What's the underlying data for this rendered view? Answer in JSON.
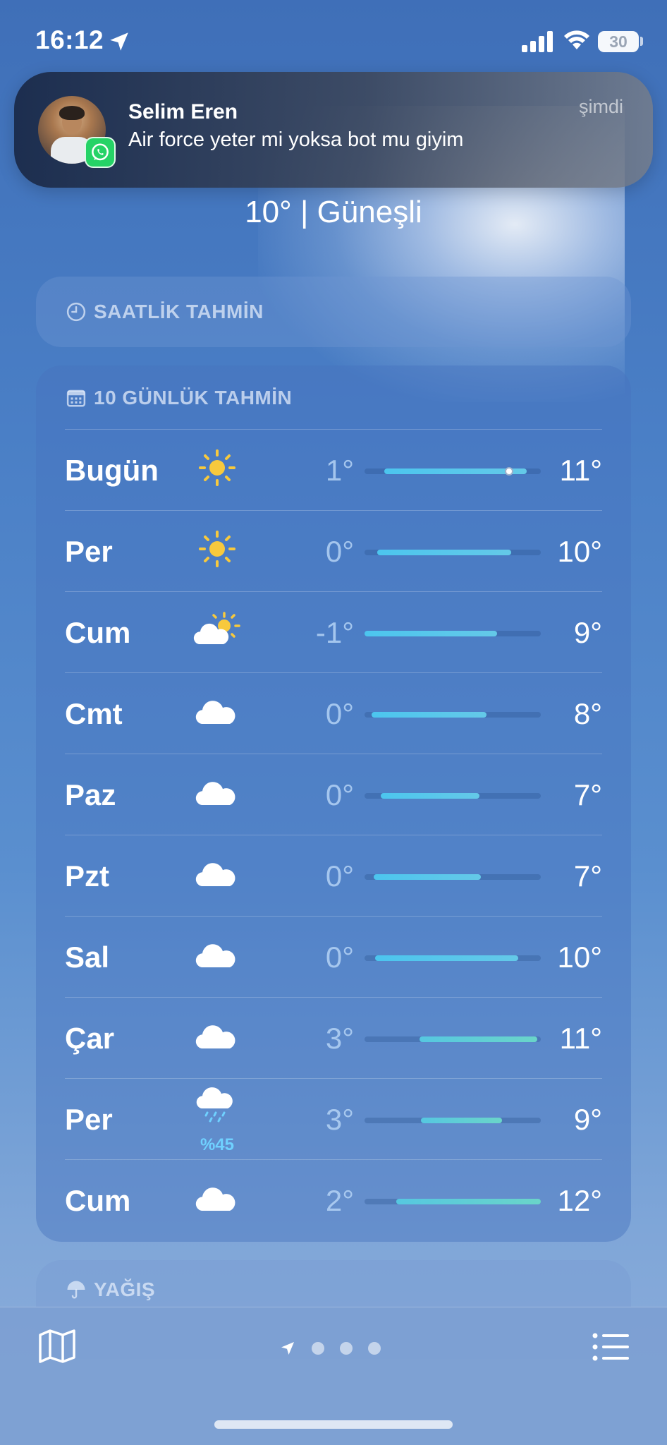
{
  "status_bar": {
    "time": "16:12",
    "battery": "30"
  },
  "notification": {
    "sender": "Selim Eren",
    "message": "Air force yeter mi yoksa bot mu giyim",
    "time": "şimdi",
    "app_icon": "whatsapp-icon"
  },
  "current": {
    "summary": "10°  |  Güneşli"
  },
  "hourly": {
    "title": "SAATLİK TAHMİN",
    "icon": "clock-icon"
  },
  "daily": {
    "title": "10 GÜNLÜK TAHMİN",
    "icon": "calendar-icon",
    "days": [
      {
        "day": "Bugün",
        "icon": "sun",
        "precip": "",
        "low": "1°",
        "high": "11°",
        "bar_start": 0.11,
        "bar_end": 0.92,
        "current": 0.82,
        "color": "blue"
      },
      {
        "day": "Per",
        "icon": "sun",
        "precip": "",
        "low": "0°",
        "high": "10°",
        "bar_start": 0.07,
        "bar_end": 0.83,
        "current": null,
        "color": "blue"
      },
      {
        "day": "Cum",
        "icon": "partly-cloudy",
        "precip": "",
        "low": "-1°",
        "high": "9°",
        "bar_start": 0.0,
        "bar_end": 0.75,
        "current": null,
        "color": "blue"
      },
      {
        "day": "Cmt",
        "icon": "cloud",
        "precip": "",
        "low": "0°",
        "high": "8°",
        "bar_start": 0.04,
        "bar_end": 0.69,
        "current": null,
        "color": "blue"
      },
      {
        "day": "Paz",
        "icon": "cloud",
        "precip": "",
        "low": "0°",
        "high": "7°",
        "bar_start": 0.09,
        "bar_end": 0.65,
        "current": null,
        "color": "blue"
      },
      {
        "day": "Pzt",
        "icon": "cloud",
        "precip": "",
        "low": "0°",
        "high": "7°",
        "bar_start": 0.05,
        "bar_end": 0.66,
        "current": null,
        "color": "blue"
      },
      {
        "day": "Sal",
        "icon": "cloud",
        "precip": "",
        "low": "0°",
        "high": "10°",
        "bar_start": 0.06,
        "bar_end": 0.87,
        "current": null,
        "color": "blue"
      },
      {
        "day": "Çar",
        "icon": "cloud",
        "precip": "",
        "low": "3°",
        "high": "11°",
        "bar_start": 0.31,
        "bar_end": 0.98,
        "current": null,
        "color": "teal"
      },
      {
        "day": "Per",
        "icon": "rain-cloud",
        "precip": "%45",
        "low": "3°",
        "high": "9°",
        "bar_start": 0.32,
        "bar_end": 0.78,
        "current": null,
        "color": "teal"
      },
      {
        "day": "Cum",
        "icon": "cloud",
        "precip": "",
        "low": "2°",
        "high": "12°",
        "bar_start": 0.18,
        "bar_end": 1.0,
        "current": null,
        "color": "teal"
      }
    ]
  },
  "rain": {
    "title": "YAĞIŞ",
    "icon": "umbrella-icon"
  },
  "toolbar": {
    "map_icon": "map-icon",
    "list_icon": "list-icon",
    "location_icon": "location-arrow-icon",
    "page_dots": 3
  }
}
